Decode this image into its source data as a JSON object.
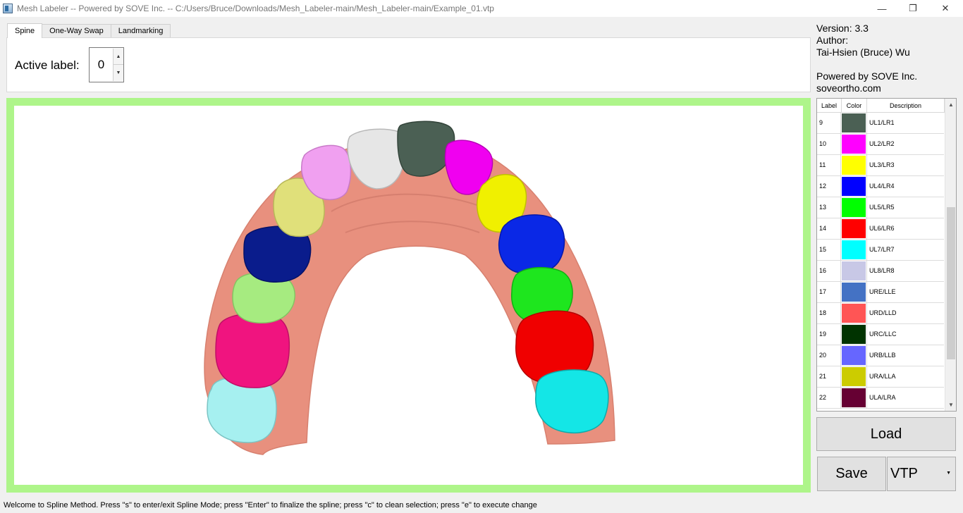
{
  "window": {
    "title": "Mesh Labeler -- Powered by SOVE Inc. -- C:/Users/Bruce/Downloads/Mesh_Labeler-main/Mesh_Labeler-main/Example_01.vtp",
    "minimize_glyph": "—",
    "restore_glyph": "❐",
    "close_glyph": "✕"
  },
  "tabs": [
    {
      "label": "Spine",
      "active": true
    },
    {
      "label": "One-Way Swap",
      "active": false
    },
    {
      "label": "Landmarking",
      "active": false
    }
  ],
  "spine_panel": {
    "active_label_text": "Active label:",
    "active_label_value": "0",
    "up_glyph": "▲",
    "down_glyph": "▼"
  },
  "info": {
    "version": "Version: 3.3",
    "author_heading": "Author:",
    "author_name": "Tai-Hsien (Bruce) Wu",
    "powered_by": "Powered by SOVE Inc.",
    "website": "soveortho.com"
  },
  "label_table": {
    "headers": {
      "label": "Label",
      "color": "Color",
      "description": "Description"
    },
    "rows": [
      {
        "label": "9",
        "color": "#4b6054",
        "description": "UL1/LR1"
      },
      {
        "label": "10",
        "color": "#ff00ff",
        "description": "UL2/LR2"
      },
      {
        "label": "11",
        "color": "#ffff00",
        "description": "UL3/LR3"
      },
      {
        "label": "12",
        "color": "#0000ff",
        "description": "UL4/LR4"
      },
      {
        "label": "13",
        "color": "#00ff00",
        "description": "UL5/LR5"
      },
      {
        "label": "14",
        "color": "#ff0000",
        "description": "UL6/LR6"
      },
      {
        "label": "15",
        "color": "#00ffff",
        "description": "UL7/LR7"
      },
      {
        "label": "16",
        "color": "#c8c8e6",
        "description": "UL8/LR8"
      },
      {
        "label": "17",
        "color": "#4472c4",
        "description": "URE/LLE"
      },
      {
        "label": "18",
        "color": "#ff5555",
        "description": "URD/LLD"
      },
      {
        "label": "19",
        "color": "#003300",
        "description": "URC/LLC"
      },
      {
        "label": "20",
        "color": "#6666ff",
        "description": "URB/LLB"
      },
      {
        "label": "21",
        "color": "#cccc00",
        "description": "URA/LLA"
      },
      {
        "label": "22",
        "color": "#660033",
        "description": "ULA/LRA"
      }
    ],
    "scroll_up_glyph": "▲",
    "scroll_down_glyph": "▼"
  },
  "buttons": {
    "load": "Load",
    "save": "Save",
    "format_value": "VTP",
    "format_arrow": "▼"
  },
  "status_text": "Welcome to Spline Method. Press \"s\" to enter/exit Spline Mode; press \"Enter\" to finalize the spline; press \"c\" to clean selection; press \"e\" to execute change",
  "viewport": {
    "border_color": "#aef58a",
    "gum_color": "#e8907e",
    "teeth": [
      {
        "name": "molar-left-back",
        "color": "#a6f0f0"
      },
      {
        "name": "molar-left-1",
        "color": "#f0147f"
      },
      {
        "name": "premolar-left-2",
        "color": "#a6eb80"
      },
      {
        "name": "premolar-left-1",
        "color": "#0a1c8c"
      },
      {
        "name": "canine-left",
        "color": "#e0e07a"
      },
      {
        "name": "incisor-left-2",
        "color": "#f0a0f0"
      },
      {
        "name": "incisor-left-1",
        "color": "#e6e6e6"
      },
      {
        "name": "incisor-right-1",
        "color": "#4b6054"
      },
      {
        "name": "incisor-right-2",
        "color": "#f000f0"
      },
      {
        "name": "canine-right",
        "color": "#f0f000"
      },
      {
        "name": "premolar-right-1",
        "color": "#0a28e6"
      },
      {
        "name": "premolar-right-2",
        "color": "#1ee61e"
      },
      {
        "name": "molar-right-1",
        "color": "#f00000"
      },
      {
        "name": "molar-right-back",
        "color": "#14e6e6"
      }
    ]
  }
}
